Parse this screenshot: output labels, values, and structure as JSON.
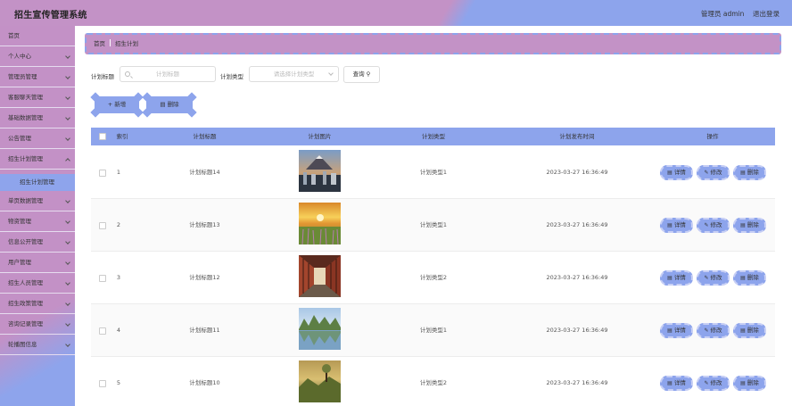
{
  "header": {
    "title": "招生宣传管理系统",
    "user": "管理员 admin",
    "logout": "退出登录"
  },
  "sidebar": {
    "items": [
      {
        "label": "首页",
        "chev": false
      },
      {
        "label": "个人中心",
        "chev": true
      },
      {
        "label": "管理员管理",
        "chev": true
      },
      {
        "label": "客服聊天管理",
        "chev": true
      },
      {
        "label": "基础数据管理",
        "chev": true
      },
      {
        "label": "公告管理",
        "chev": true
      },
      {
        "label": "招生计划管理",
        "chev": true,
        "open": true
      },
      {
        "label": "单页数据管理",
        "chev": true
      },
      {
        "label": "物资管理",
        "chev": true
      },
      {
        "label": "信息公开管理",
        "chev": true
      },
      {
        "label": "用户管理",
        "chev": true
      },
      {
        "label": "招生人员管理",
        "chev": true
      },
      {
        "label": "招生政策管理",
        "chev": true
      },
      {
        "label": "咨询记录管理",
        "chev": true
      },
      {
        "label": "轮播图信息",
        "chev": true
      }
    ],
    "submenu": "招生计划管理"
  },
  "breadcrumb": {
    "home": "首页",
    "current": "招生计划"
  },
  "search": {
    "title_label": "计划标题",
    "title_placeholder": "计划标题",
    "type_label": "计划类型",
    "type_placeholder": "请选择计划类型",
    "query": "查询"
  },
  "actions": {
    "add": "新增",
    "delete": "删除"
  },
  "table": {
    "headers": {
      "index": "索引",
      "title": "计划标题",
      "image": "计划图片",
      "type": "计划类型",
      "time": "计划发布时间",
      "ops": "操作"
    },
    "ops": {
      "detail": "详情",
      "edit": "修改",
      "delete": "删除"
    },
    "rows": [
      {
        "index": "1",
        "title": "计划标题14",
        "type": "计划类型1",
        "time": "2023-03-27 16:36:49"
      },
      {
        "index": "2",
        "title": "计划标题13",
        "type": "计划类型1",
        "time": "2023-03-27 16:36:49"
      },
      {
        "index": "3",
        "title": "计划标题12",
        "type": "计划类型2",
        "time": "2023-03-27 16:36:49"
      },
      {
        "index": "4",
        "title": "计划标题11",
        "type": "计划类型1",
        "time": "2023-03-27 16:36:49"
      },
      {
        "index": "5",
        "title": "计划标题10",
        "type": "计划类型2",
        "time": "2023-03-27 16:36:49"
      }
    ]
  },
  "colors": {
    "pink": "#c392c6",
    "blue": "#8da4ec"
  }
}
